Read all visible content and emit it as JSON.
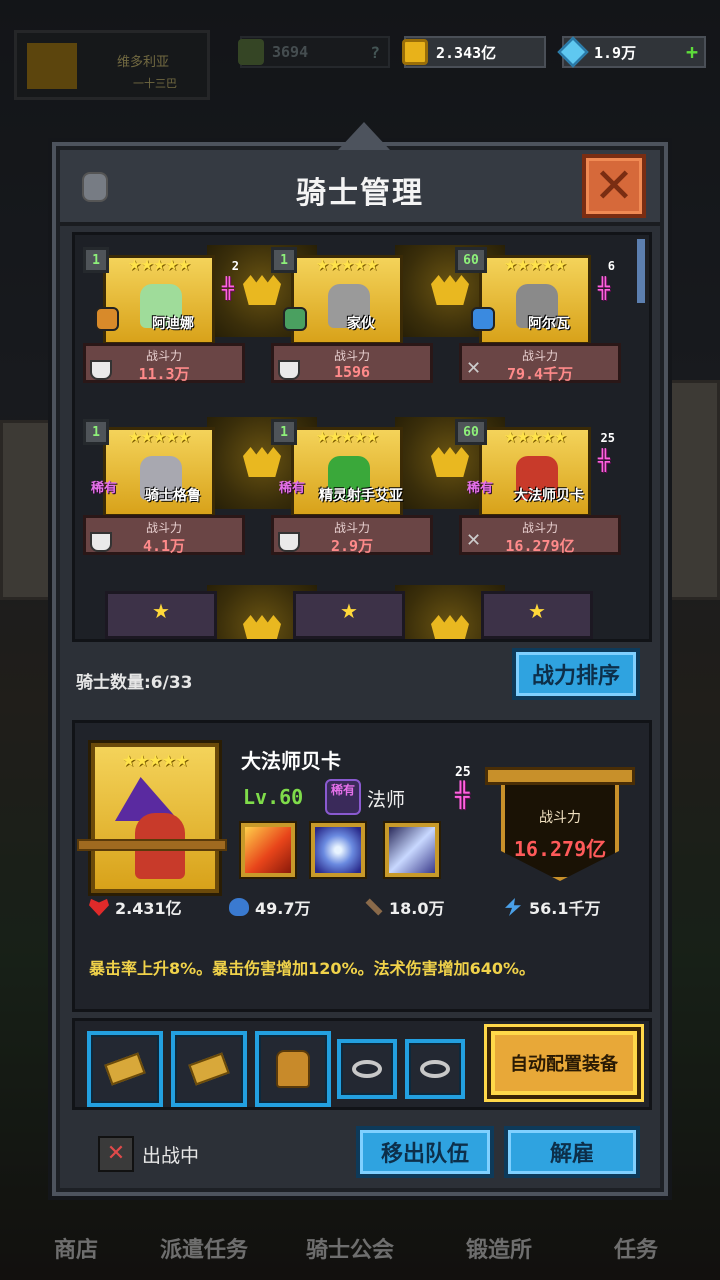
{
  "hud": {
    "player_name": "维多利亚",
    "player_sub": "一十三巴",
    "power_value": "3694",
    "power_help": "?",
    "gold_value": "2.343亿",
    "gem_value": "1.9万",
    "gem_add": "+"
  },
  "bottom_nav": [
    "商店",
    "派遣任务",
    "骑士公会",
    "锻造所",
    "任务"
  ],
  "modal": {
    "title": "骑士管理",
    "close_label": "✕"
  },
  "roster": {
    "power_label": "战斗力",
    "heroes": [
      {
        "name": "阿迪娜",
        "level": "1",
        "stars": "★★★★★",
        "rank": "2",
        "rare": "",
        "power": "11.3万",
        "color": "#9fdc9a"
      },
      {
        "name": "家伙",
        "level": "1",
        "stars": "★★★★★",
        "rank": "",
        "rare": "",
        "power": "1596",
        "color": "#9a9a9a"
      },
      {
        "name": "阿尔瓦",
        "level": "60",
        "stars": "★★★★★",
        "rank": "6",
        "rare": "",
        "power": "79.4千万",
        "color": "#8a8a8a"
      },
      {
        "name": "骑士格鲁",
        "level": "1",
        "stars": "★★★★★",
        "rank": "",
        "rare": "稀有",
        "power": "4.1万",
        "color": "#a8a8b0"
      },
      {
        "name": "精灵射手艾亚",
        "level": "1",
        "stars": "★★★★★",
        "rank": "",
        "rare": "稀有",
        "power": "2.9万",
        "color": "#3aa83a"
      },
      {
        "name": "大法师贝卡",
        "level": "60",
        "stars": "★★★★★",
        "rank": "25",
        "rare": "稀有",
        "power": "16.279亿",
        "color": "#c83a2a"
      }
    ],
    "empty_star": "★"
  },
  "knight_count": "骑士数量:6/33",
  "sort_button": "战力排序",
  "detail": {
    "name": "大法师贝卡",
    "stars": "★★★★★",
    "level": "Lv.60",
    "rare": "稀有",
    "class": "法师",
    "rank_num": "25",
    "power_label": "战斗力",
    "power_value": "16.279亿",
    "hp": "2.431亿",
    "mp": "49.7万",
    "attack": "18.0万",
    "speed": "56.1千万",
    "passive": "暴击率上升8%。暴击伤害增加120%。法术伤害增加640%。"
  },
  "equip": {
    "auto_button": "自动配置装备"
  },
  "status_text": "出战中",
  "remove_button": "移出队伍",
  "dismiss_button": "解雇",
  "colors": {
    "accent_blue": "#2fa3e0",
    "gold": "#e8a838",
    "power_red": "#ff5a5a",
    "close_orange": "#d6693a"
  }
}
